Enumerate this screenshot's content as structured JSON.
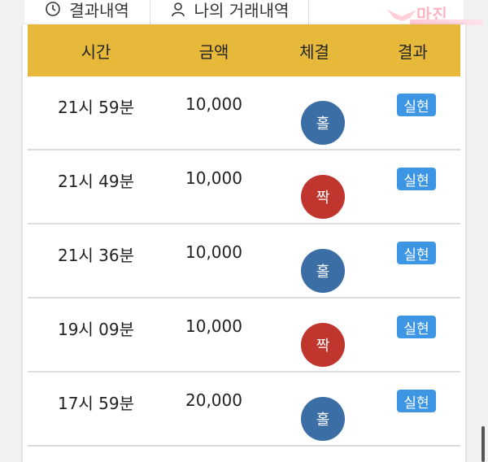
{
  "tabs": [
    {
      "label": "결과내역",
      "icon": "clock-icon"
    },
    {
      "label": "나의 거래내역",
      "icon": "user-icon"
    }
  ],
  "logo": {
    "text": "마진"
  },
  "table": {
    "header_color": "#e6b93a",
    "headers": {
      "time": "시간",
      "amount": "금액",
      "fill": "체결",
      "result": "결과"
    },
    "rows": [
      {
        "time": "21시 59분",
        "amount": "10,000",
        "fill": "홀",
        "fill_color": "#3a6ea5",
        "result": "실현"
      },
      {
        "time": "21시 49분",
        "amount": "10,000",
        "fill": "짝",
        "fill_color": "#c0362f",
        "result": "실현"
      },
      {
        "time": "21시 36분",
        "amount": "10,000",
        "fill": "홀",
        "fill_color": "#3a6ea5",
        "result": "실현"
      },
      {
        "time": "19시 09분",
        "amount": "10,000",
        "fill": "짝",
        "fill_color": "#c0362f",
        "result": "실현"
      },
      {
        "time": "17시 59분",
        "amount": "20,000",
        "fill": "홀",
        "fill_color": "#3a6ea5",
        "result": "실현"
      }
    ]
  },
  "colors": {
    "odd": "#3a6ea5",
    "even": "#c0362f",
    "badge": "#3d96e3"
  }
}
